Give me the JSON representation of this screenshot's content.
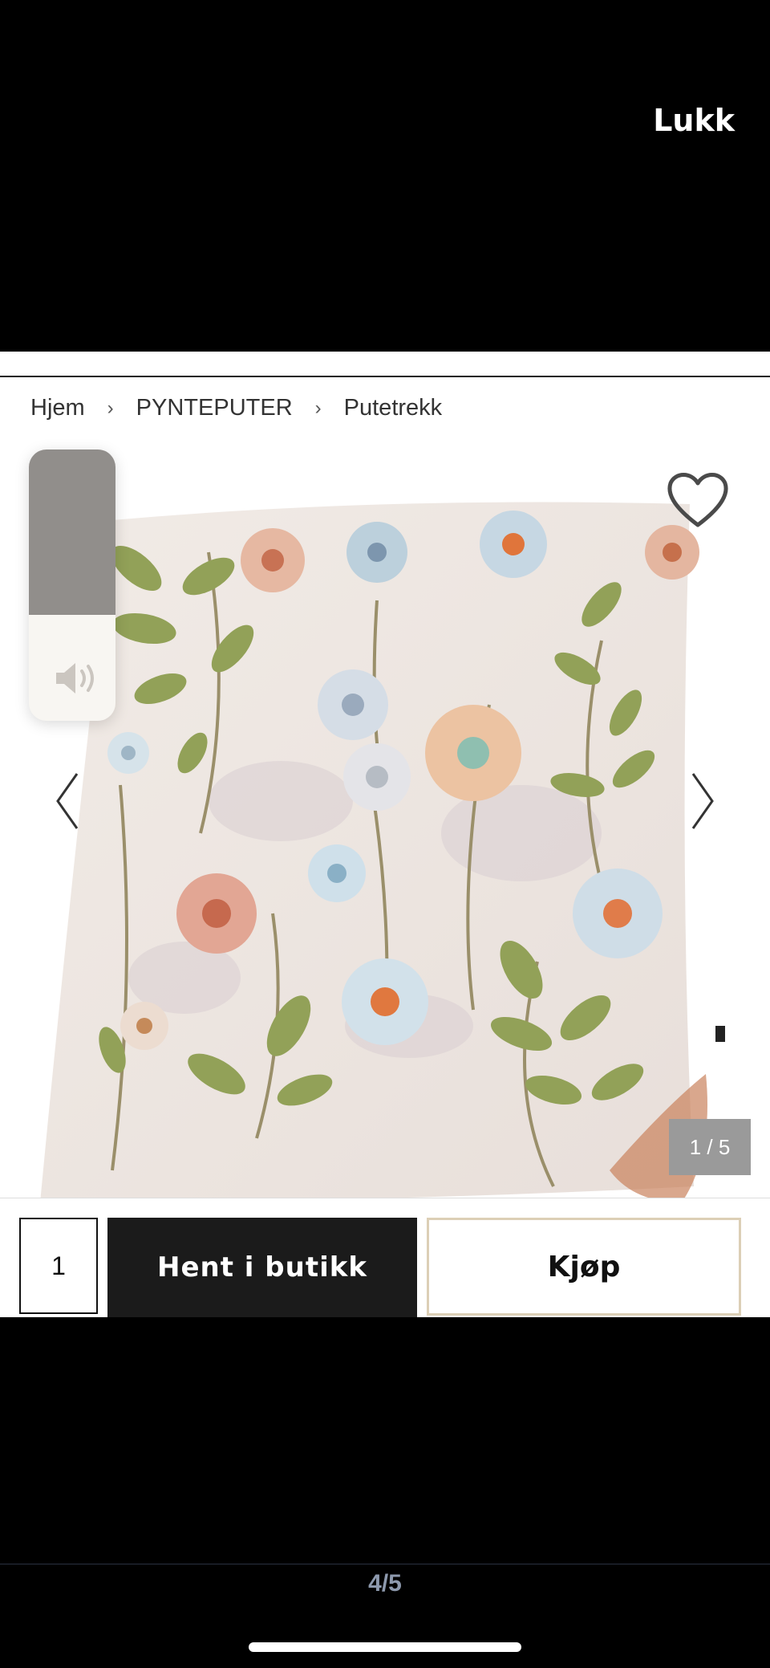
{
  "story": {
    "close_label": "Lukk",
    "page_indicator": "4/5"
  },
  "breadcrumb": [
    "Hjem",
    "PYNTEPUTER",
    "Putetrekk"
  ],
  "gallery": {
    "counter": "1 / 5"
  },
  "volume": {
    "level": 0.61
  },
  "purchase": {
    "quantity": "1",
    "store_pickup_label": "Hent i butikk",
    "buy_label": "Kjøp"
  }
}
